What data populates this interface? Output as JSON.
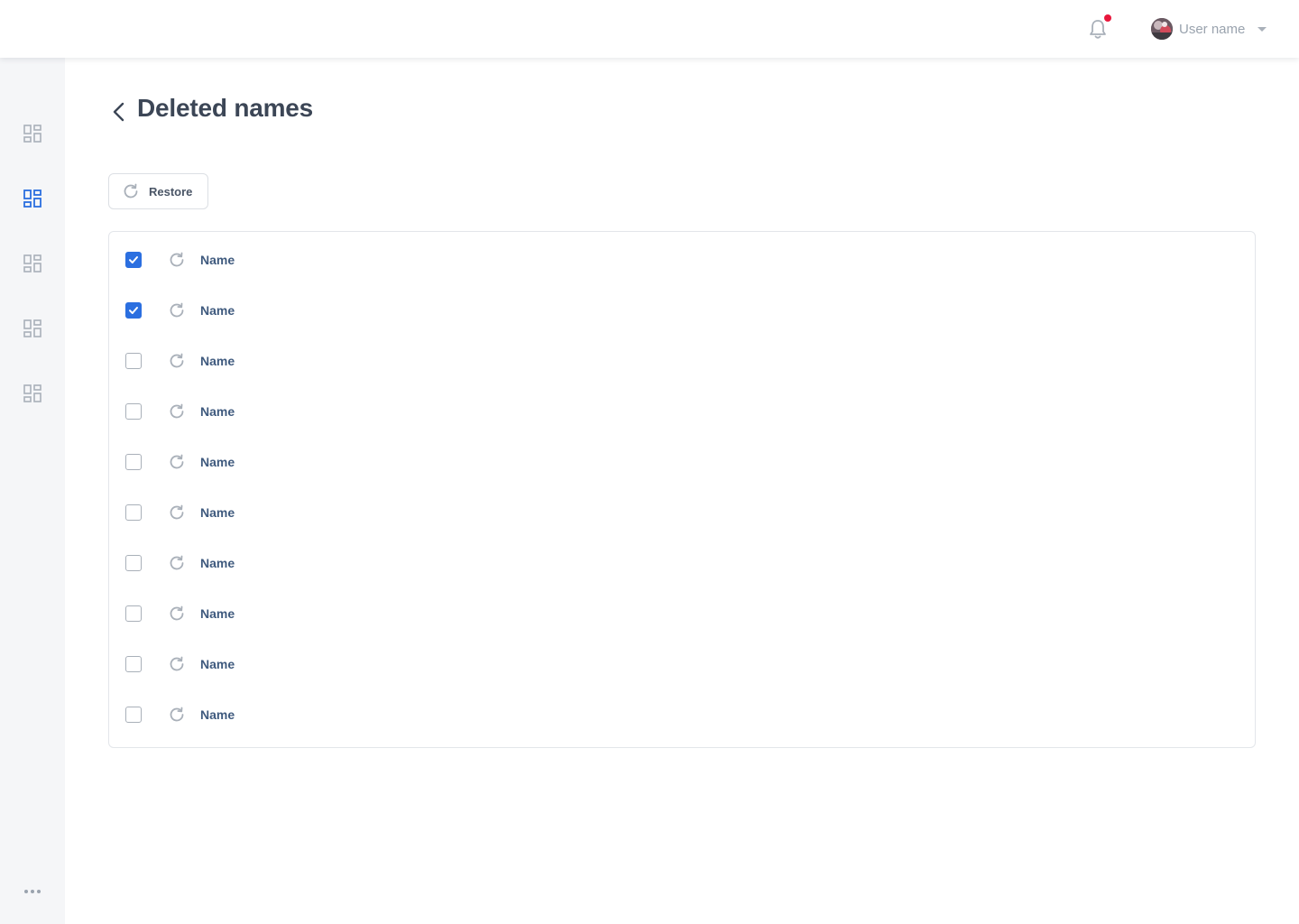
{
  "header": {
    "user_name": "User name",
    "has_notification": true,
    "notification_color": "#e8163b"
  },
  "sidebar": {
    "items": [
      {
        "icon": "dashboard-icon",
        "active": false
      },
      {
        "icon": "dashboard-icon",
        "active": true
      },
      {
        "icon": "dashboard-icon",
        "active": false
      },
      {
        "icon": "dashboard-icon",
        "active": false
      },
      {
        "icon": "dashboard-icon",
        "active": false
      }
    ],
    "more_icon": "more-horizontal-icon",
    "active_color": "#2b6fe0",
    "inactive_color": "#a9b0b9"
  },
  "page": {
    "title": "Deleted names",
    "back_icon": "chevron-left-icon"
  },
  "toolbar": {
    "restore_label": "Restore",
    "restore_icon": "refresh-icon"
  },
  "list": {
    "rows": [
      {
        "name": "Name",
        "checked": true
      },
      {
        "name": "Name",
        "checked": true
      },
      {
        "name": "Name",
        "checked": false
      },
      {
        "name": "Name",
        "checked": false
      },
      {
        "name": "Name",
        "checked": false
      },
      {
        "name": "Name",
        "checked": false
      },
      {
        "name": "Name",
        "checked": false
      },
      {
        "name": "Name",
        "checked": false
      },
      {
        "name": "Name",
        "checked": false
      },
      {
        "name": "Name",
        "checked": false
      }
    ]
  }
}
